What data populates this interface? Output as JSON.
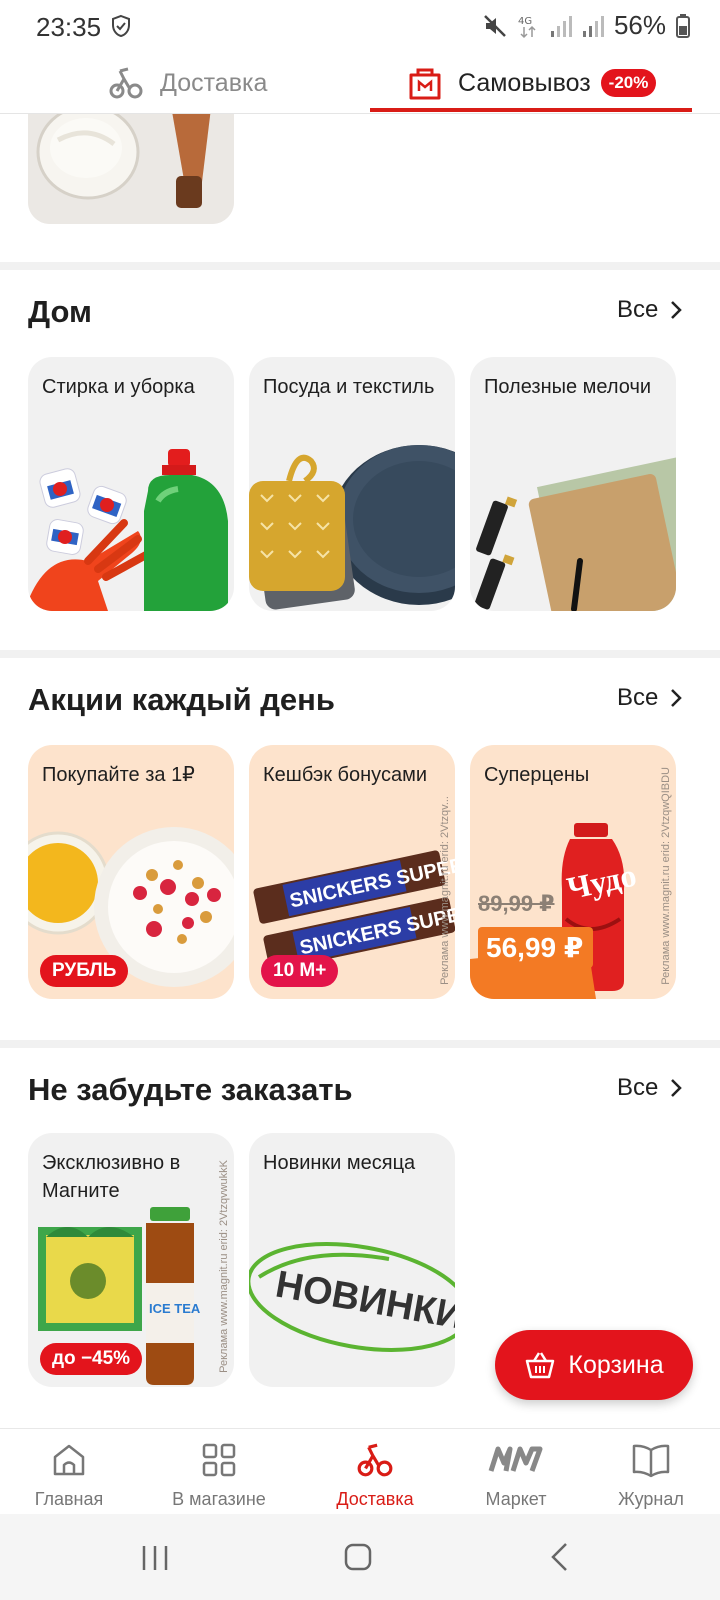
{
  "status_bar": {
    "time": "23:35",
    "network": "4G",
    "battery": "56%"
  },
  "mode_tabs": {
    "delivery_label": "Доставка",
    "pickup_label": "Самовывоз",
    "pickup_badge": "-20%",
    "active": "pickup"
  },
  "sections": [
    {
      "title": "Дом",
      "all_label": "Все",
      "cards": [
        {
          "title": "Стирка и уборка"
        },
        {
          "title": "Посуда и текстиль"
        },
        {
          "title": "Полезные мелочи"
        }
      ]
    },
    {
      "title": "Акции каждый день",
      "all_label": "Все",
      "cards": [
        {
          "title": "Покупайте за 1₽",
          "tag": "РУБЛЬ"
        },
        {
          "title": "Кешбэк бонусами",
          "tag": "10 M+",
          "ad_note": "Реклама www.magnit.ru erid: 2Vtzqv...",
          "product_text": "SNICKERS SUPER"
        },
        {
          "title": "Суперцены",
          "old_price": "89,99 ₽",
          "new_price": "56,99 ₽",
          "ad_note": "Реклама www.magnit.ru erid: 2VtzqwQIBDU",
          "product_text": "Чудо"
        }
      ]
    },
    {
      "title": "Не забудьте заказать",
      "all_label": "Все",
      "cards": [
        {
          "title": "Эксклюзивно в Магните",
          "tag": "до −45%",
          "ad_note": "Реклама www.magnit.ru erid: 2VtzqvwukkK",
          "product_text": "ICE TEA"
        },
        {
          "title": "Новинки месяца",
          "stamp": "НОВИНКИ"
        }
      ]
    }
  ],
  "basket": {
    "label": "Корзина"
  },
  "bottom_nav": [
    {
      "label": "Главная",
      "icon": "home-icon"
    },
    {
      "label": "В магазине",
      "icon": "grid-icon"
    },
    {
      "label": "Доставка",
      "icon": "bike-icon",
      "active": true
    },
    {
      "label": "Маркет",
      "icon": "market-logo-icon"
    },
    {
      "label": "Журнал",
      "icon": "book-icon"
    }
  ],
  "colors": {
    "accent": "#e3141c",
    "promo_bg": "#fde3cc",
    "card_bg": "#f1f1f1"
  }
}
